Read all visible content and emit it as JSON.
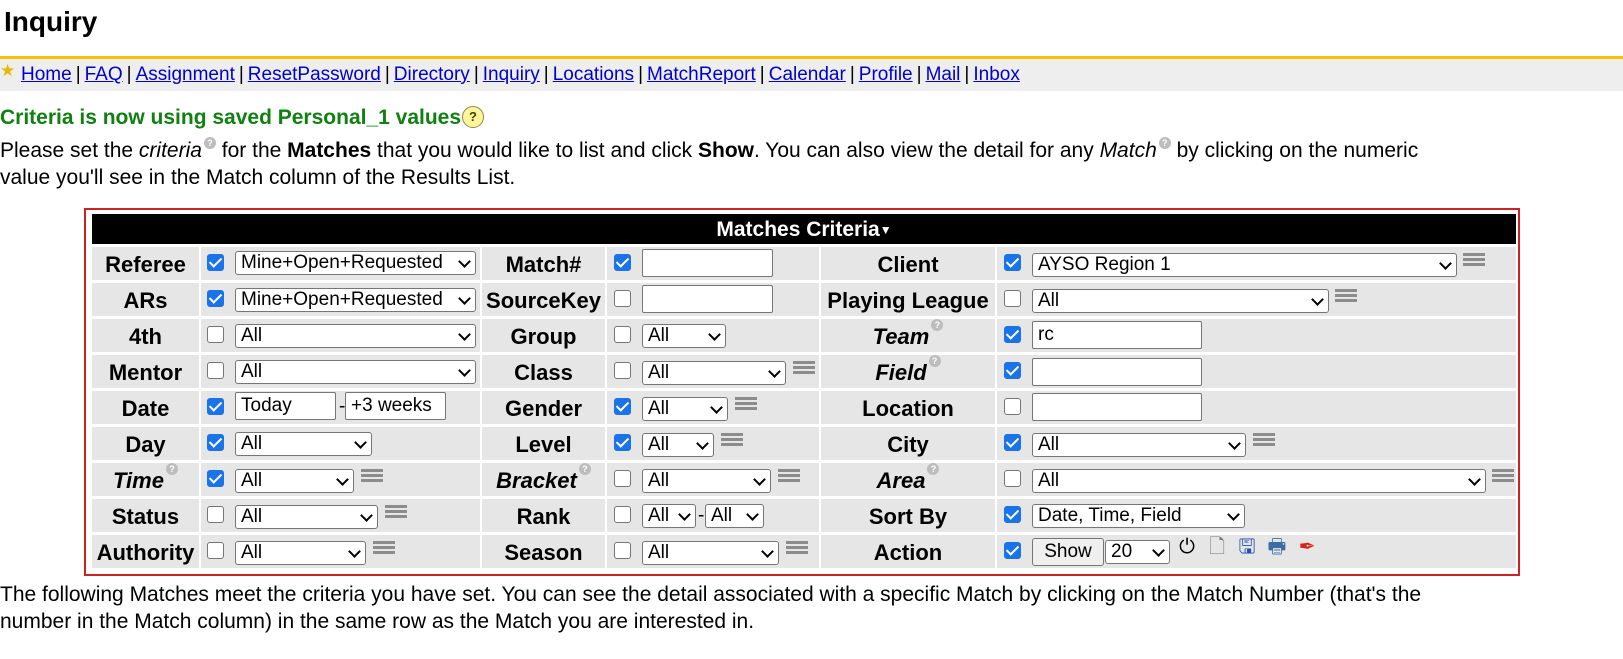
{
  "page": {
    "title": "Inquiry"
  },
  "nav": {
    "icon": "star-icon",
    "separator": "|",
    "links": [
      "Home",
      "FAQ",
      "Assignment",
      "ResetPassword",
      "Directory",
      "Inquiry",
      "Locations",
      "MatchReport",
      "Calendar",
      "Profile",
      "Mail",
      "Inbox"
    ]
  },
  "notice": {
    "text": "Criteria is now using saved Personal_1 values",
    "help": "?"
  },
  "intro": {
    "p1": "Please set the ",
    "criteria": "criteria",
    "p2": " for the ",
    "matches": "Matches",
    "p3": " that you would like to list and click ",
    "show": "Show",
    "p4": ". You can also view the detail for any ",
    "match": "Match",
    "p5": " by clicking on the numeric",
    "line2": "value you'll see in the Match column of the Results List."
  },
  "criteria": {
    "title": "Matches Criteria",
    "referee": {
      "label": "Referee",
      "value": "Mine+Open+Requested"
    },
    "ars": {
      "label": "ARs",
      "value": "Mine+Open+Requested"
    },
    "fourth": {
      "label": "4th",
      "value": "All"
    },
    "mentor": {
      "label": "Mentor",
      "value": "All"
    },
    "date": {
      "label": "Date",
      "from": "Today",
      "to": "+3 weeks",
      "sep": "-"
    },
    "day": {
      "label": "Day",
      "value": "All"
    },
    "time": {
      "label": "Time",
      "value": "All"
    },
    "status": {
      "label": "Status",
      "value": "All"
    },
    "authority": {
      "label": "Authority",
      "value": "All"
    },
    "matchnum": {
      "label": "Match#",
      "value": ""
    },
    "sourcekey": {
      "label": "SourceKey",
      "value": ""
    },
    "group": {
      "label": "Group",
      "value": "All"
    },
    "class": {
      "label": "Class",
      "value": "All"
    },
    "gender": {
      "label": "Gender",
      "value": "All"
    },
    "level": {
      "label": "Level",
      "value": "All"
    },
    "bracket": {
      "label": "Bracket",
      "value": "All"
    },
    "rank": {
      "label": "Rank",
      "from": "All",
      "to": "All",
      "sep": "-"
    },
    "season": {
      "label": "Season",
      "value": "All"
    },
    "client": {
      "label": "Client",
      "value": "AYSO Region 1"
    },
    "playing_league": {
      "label": "Playing League",
      "value": "All"
    },
    "team": {
      "label": "Team",
      "value": "rc"
    },
    "field": {
      "label": "Field",
      "value": ""
    },
    "location": {
      "label": "Location",
      "value": ""
    },
    "city": {
      "label": "City",
      "value": "All"
    },
    "area": {
      "label": "Area",
      "value": "All"
    },
    "sortby": {
      "label": "Sort By",
      "value": "Date, Time, Field"
    },
    "action": {
      "label": "Action",
      "button": "Show",
      "count": "20"
    }
  },
  "footer": {
    "line1": "The following Matches meet the criteria you have set. You can see the detail associated with a specific Match by clicking on the Match Number (that's the",
    "line2": "number in the Match column) in the same row as the Match you are interested in."
  },
  "colors": {
    "accent": "#f2c300",
    "notice": "#108010",
    "border": "#cc2222",
    "link": "#0000cc",
    "check": "#1a73e8"
  }
}
